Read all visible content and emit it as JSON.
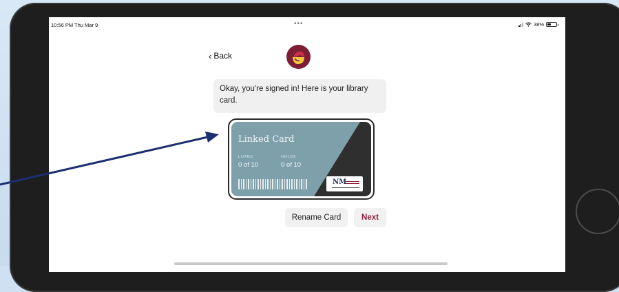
{
  "status_bar": {
    "time": "10:56 PM  Thu Mar 9",
    "dots": "•••",
    "battery_text": "38%",
    "battery_level": 0.38
  },
  "header": {
    "back_label": "Back",
    "logo_icon": "libby-logo-icon"
  },
  "message": {
    "text": "Okay, you're signed in! Here is your library card."
  },
  "card": {
    "title": "Linked Card",
    "loans_label": "LOANS",
    "loans_value": "0 of 10",
    "holds_label": "HOLDS",
    "holds_value": "0 of 10",
    "badge_text": "NM",
    "colors": {
      "card": "#7ea0aa",
      "dark": "#2f2f2f",
      "brand": "#7d1e34"
    }
  },
  "actions": {
    "rename_label": "Rename Card",
    "next_label": "Next"
  },
  "annotation": {
    "color": "#1c2f6e",
    "icon": "pointer-arrow-icon"
  }
}
